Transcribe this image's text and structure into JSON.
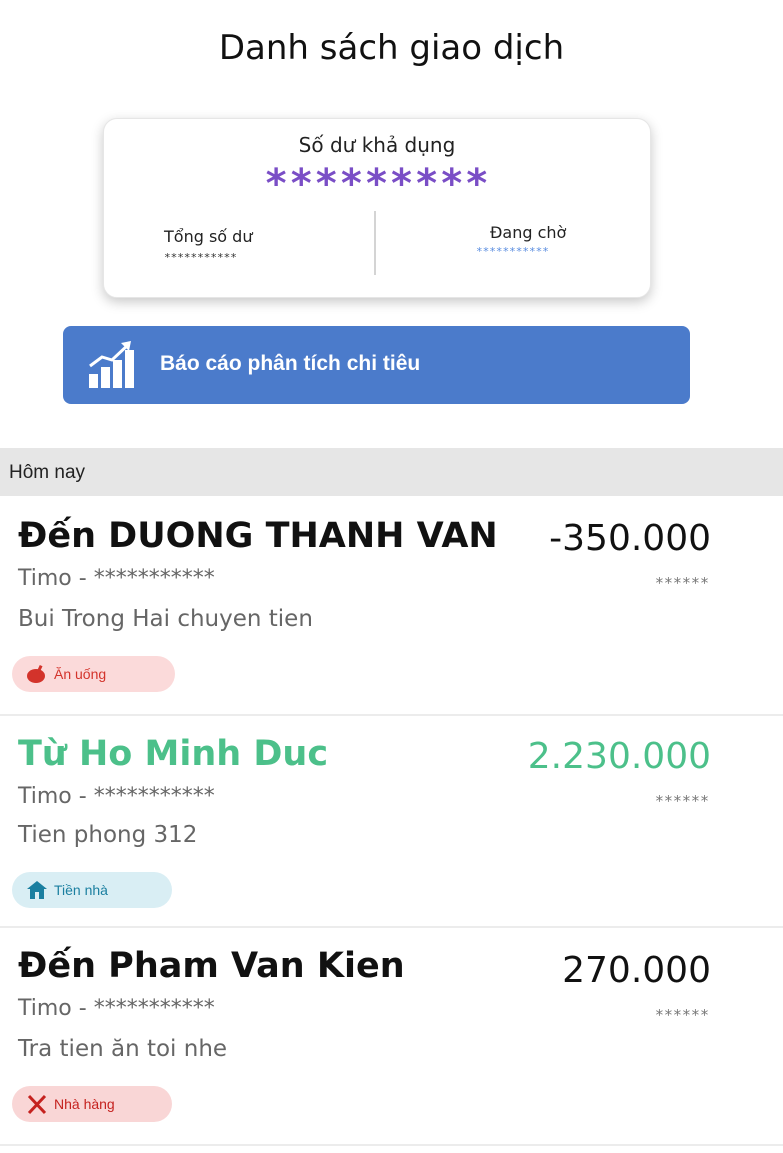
{
  "page": {
    "title": "Danh sách giao dịch"
  },
  "balance": {
    "label": "Số dư khả dụng",
    "value": "*********",
    "total_label": "Tổng số dư",
    "total_value": "***********",
    "pending_label": "Đang chờ",
    "pending_value": "***********"
  },
  "report_button": {
    "label": "Báo cáo phân tích chi tiêu",
    "icon": "bar-chart-growth-icon"
  },
  "section": {
    "label": "Hôm nay"
  },
  "transactions": [
    {
      "title": "Đến DUONG THANH VAN",
      "amount": "-350.000",
      "account": "Timo - ***********",
      "stars": "******",
      "memo": "Bui Trong Hai chuyen tien",
      "tag": "Ăn uống",
      "tag_icon": "food-icon",
      "color": "#111111"
    },
    {
      "title": "Từ Ho Minh Duc",
      "amount": "2.230.000",
      "account": "Timo - ***********",
      "stars": "******",
      "memo": "Tien phong 312",
      "tag": "Tiền nhà",
      "tag_icon": "house-icon",
      "color": "#4cc08a"
    },
    {
      "title": "Đến Pham Van Kien",
      "amount": "270.000",
      "account": "Timo - ***********",
      "stars": "******",
      "memo": "Tra tien ăn toi nhe",
      "tag": "Nhà hàng",
      "tag_icon": "fork-knife-icon",
      "color": "#111111"
    }
  ],
  "colors": {
    "accent_blue": "#4b7bcb",
    "balance_purple": "#7a4ec6",
    "credit_green": "#4cc08a",
    "section_gray": "#e6e6e6"
  }
}
